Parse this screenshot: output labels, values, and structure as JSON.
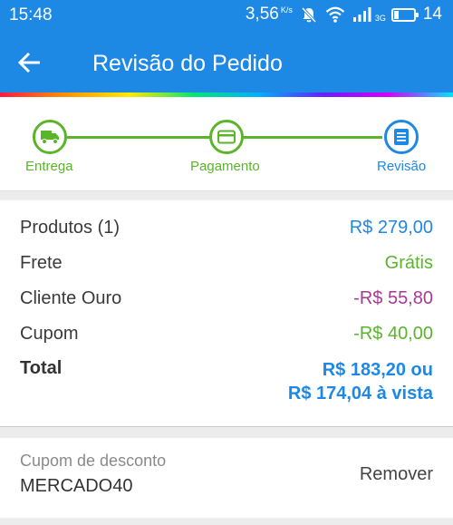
{
  "status_bar": {
    "time": "15:48",
    "net_speed": "3,56",
    "net_speed_unit": "K/s",
    "network_type": "3G",
    "battery": "14"
  },
  "app_bar": {
    "title": "Revisão do Pedido"
  },
  "stepper": {
    "steps": [
      {
        "label": "Entrega",
        "icon": "truck-icon",
        "state": "done"
      },
      {
        "label": "Pagamento",
        "icon": "card-icon",
        "state": "done"
      },
      {
        "label": "Revisão",
        "icon": "list-icon",
        "state": "active"
      }
    ]
  },
  "summary": {
    "rows": [
      {
        "label": "Produtos (1)",
        "value": "R$ 279,00"
      },
      {
        "label": "Frete",
        "value": "Grátis"
      },
      {
        "label": "Cliente Ouro",
        "value": "-R$ 55,80"
      },
      {
        "label": "Cupom",
        "value": "-R$ 40,00"
      }
    ],
    "total": {
      "label": "Total",
      "value_line1": "R$ 183,20 ou",
      "value_line2": "R$ 174,04 à vista"
    }
  },
  "coupon": {
    "label": "Cupom de desconto",
    "code": "MERCADO40",
    "remove_label": "Remover"
  },
  "colors": {
    "primary": "#1e88e5",
    "success": "#5ab52a",
    "gold_discount": "#a83a96"
  }
}
